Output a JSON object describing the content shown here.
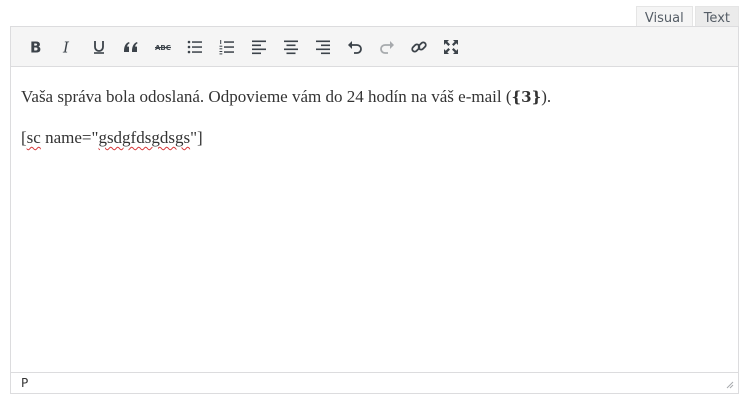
{
  "tabs": [
    {
      "label": "Visual",
      "active": true
    },
    {
      "label": "Text",
      "active": false
    }
  ],
  "toolbar": {
    "buttons": [
      {
        "name": "bold-icon",
        "bold_label": "B"
      },
      {
        "name": "italic-icon",
        "italic_label": "I"
      },
      {
        "name": "underline-icon"
      },
      {
        "name": "blockquote-icon"
      },
      {
        "name": "strikethrough-icon",
        "strike_label": "ABC"
      },
      {
        "name": "bullet-list-icon"
      },
      {
        "name": "numbered-list-icon"
      },
      {
        "name": "align-left-icon"
      },
      {
        "name": "align-center-icon"
      },
      {
        "name": "align-right-icon"
      },
      {
        "name": "undo-icon"
      },
      {
        "name": "redo-icon"
      },
      {
        "name": "link-icon"
      },
      {
        "name": "fullscreen-icon"
      }
    ]
  },
  "content": {
    "line1_text": "Vaša správa bola odoslaná. Odpovieme vám do 24 hodín na váš e-mail (",
    "line1_tag": "{3}",
    "line1_end": ").",
    "line2_pre": "[",
    "line2_sc": "sc",
    "line2_mid": " name=\"",
    "line2_name": "gsdgfdsgdsgs",
    "line2_end": "\"]"
  },
  "statusbar": {
    "path": "P"
  },
  "colors": {
    "icon": "#3c434a",
    "disabled_icon": "#a7aaad",
    "border": "#dcdcde",
    "toolbar_bg": "#f5f5f5"
  }
}
